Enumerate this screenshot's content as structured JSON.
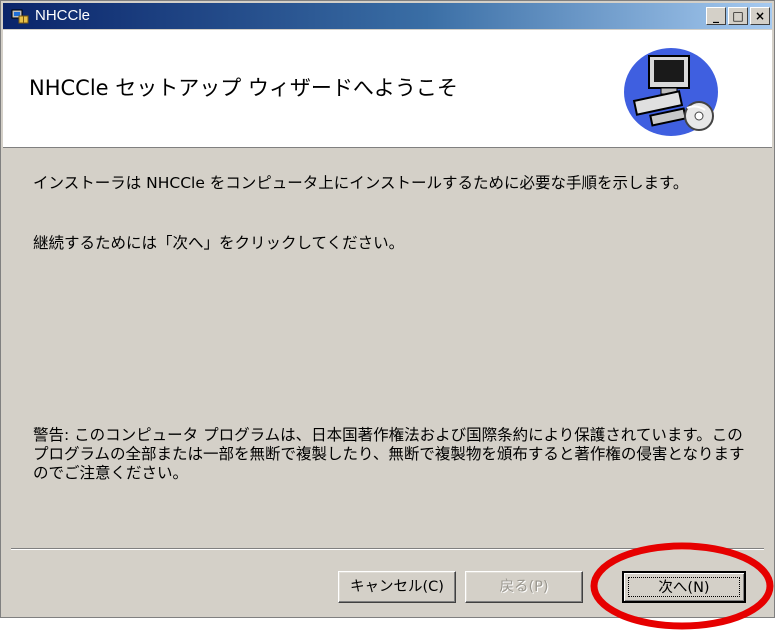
{
  "window": {
    "title": "NHCCle",
    "minimize_glyph": "_",
    "maximize_glyph": "□",
    "close_glyph": "×"
  },
  "header": {
    "title": "NHCCle セットアップ ウィザードへようこそ",
    "graphic_icon": "computer-installer-icon"
  },
  "body": {
    "intro": "インストーラは NHCCle をコンピュータ上にインストールするために必要な手順を示します。",
    "continue_note": "継続するためには「次へ」をクリックしてください。",
    "warning": "警告: このコンピュータ プログラムは、日本国著作権法および国際条約により保護されています。このプログラムの全部または一部を無断で複製したり、無断で複製物を頒布すると著作権の侵害となりますのでご注意ください。"
  },
  "buttons": {
    "cancel": "キャンセル(C)",
    "back": "戻る(P)",
    "next": "次へ(N)"
  },
  "annotation": {
    "highlight_color": "#e60000"
  }
}
